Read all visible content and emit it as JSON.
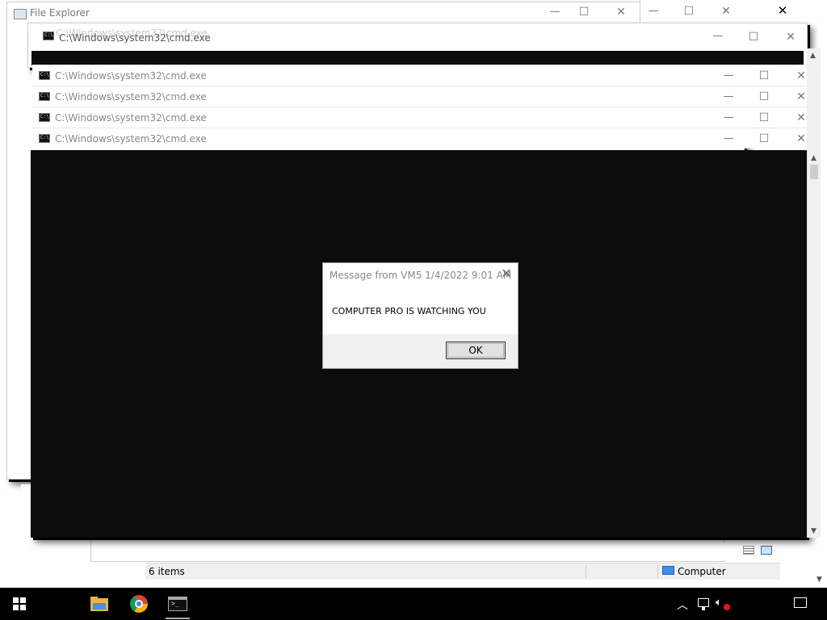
{
  "file_explorer": {
    "title": "File Explorer",
    "status_items": "6 items",
    "status_location": "Computer"
  },
  "back_cmd_window": {
    "title": "C:\\Windows\\system32\\cmd.exe"
  },
  "ghost_title": "C:\\Windows\\system32\\cmd.exe",
  "cmd_bars": [
    {
      "title": "C:\\Windows\\system32\\cmd.exe"
    },
    {
      "title": "C:\\Windows\\system32\\cmd.exe"
    },
    {
      "title": "C:\\Windows\\system32\\cmd.exe"
    },
    {
      "title": "C:\\Windows\\system32\\cmd.exe"
    }
  ],
  "dialog": {
    "title": "Message from VM5 1/4/2022 9:01 AM",
    "message": "COMPUTER PRO IS WATCHING YOU",
    "ok_label": "OK"
  },
  "window_controls": {
    "minimize": "—",
    "maximize": "☐",
    "close": "✕"
  },
  "colors": {
    "console_bg": "#0c0c0c",
    "taskbar_bg": "#000000",
    "dialog_bg": "#f0f0f0",
    "titlebar_text": "#888888"
  },
  "taskbar": {
    "icons": [
      "windows-start-icon",
      "file-explorer-icon",
      "chrome-icon",
      "cmd-icon"
    ],
    "tray_icons": [
      "chevron-up-icon",
      "network-icon",
      "volume-muted-icon",
      "notifications-icon"
    ]
  }
}
